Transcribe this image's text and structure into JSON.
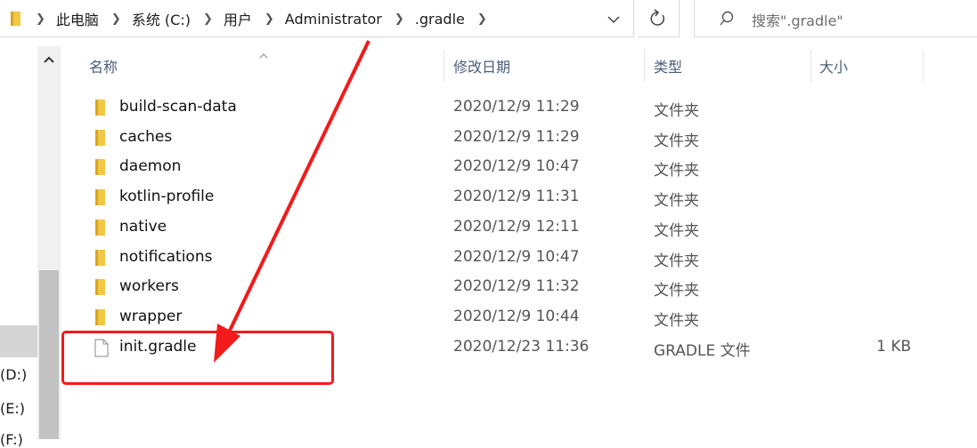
{
  "breadcrumbs": [
    "此电脑",
    "系统 (C:)",
    "用户",
    "Administrator",
    ".gradle"
  ],
  "search": {
    "placeholder": "搜索\".gradle\""
  },
  "columns": {
    "name": "名称",
    "modified": "修改日期",
    "type": "类型",
    "size": "大小"
  },
  "nav": {
    "drives": [
      "(D:)",
      "(E:)",
      "(F:)"
    ]
  },
  "files": [
    {
      "name": "build-scan-data",
      "modified": "2020/12/9 11:29",
      "type": "文件夹",
      "size": "",
      "kind": "folder"
    },
    {
      "name": "caches",
      "modified": "2020/12/9 11:29",
      "type": "文件夹",
      "size": "",
      "kind": "folder"
    },
    {
      "name": "daemon",
      "modified": "2020/12/9 10:47",
      "type": "文件夹",
      "size": "",
      "kind": "folder"
    },
    {
      "name": "kotlin-profile",
      "modified": "2020/12/9 11:31",
      "type": "文件夹",
      "size": "",
      "kind": "folder"
    },
    {
      "name": "native",
      "modified": "2020/12/9 12:11",
      "type": "文件夹",
      "size": "",
      "kind": "folder"
    },
    {
      "name": "notifications",
      "modified": "2020/12/9 10:47",
      "type": "文件夹",
      "size": "",
      "kind": "folder"
    },
    {
      "name": "workers",
      "modified": "2020/12/9 11:32",
      "type": "文件夹",
      "size": "",
      "kind": "folder"
    },
    {
      "name": "wrapper",
      "modified": "2020/12/9 10:44",
      "type": "文件夹",
      "size": "",
      "kind": "folder"
    },
    {
      "name": "init.gradle",
      "modified": "2020/12/23 11:36",
      "type": "GRADLE 文件",
      "size": "1 KB",
      "kind": "file"
    }
  ],
  "colors": {
    "folder": "#f2c744",
    "folderDark": "#d9a520",
    "annotation": "#f21a1a",
    "header": "#4a5d7a"
  }
}
